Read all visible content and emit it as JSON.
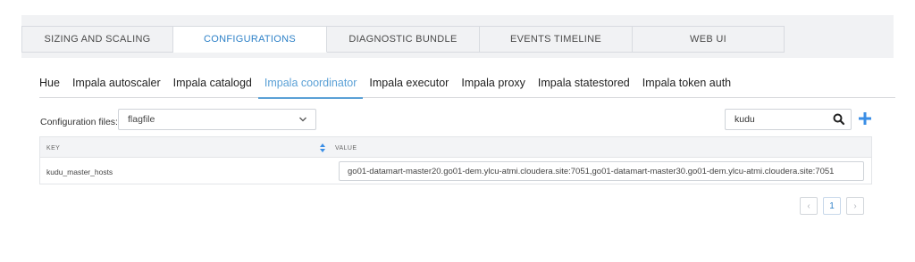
{
  "top_tabs": [
    {
      "label": "SIZING AND SCALING"
    },
    {
      "label": "CONFIGURATIONS"
    },
    {
      "label": "DIAGNOSTIC BUNDLE"
    },
    {
      "label": "EVENTS TIMELINE"
    },
    {
      "label": "WEB UI"
    }
  ],
  "active_top_tab": "CONFIGURATIONS",
  "sub_tabs": [
    {
      "label": "Hue"
    },
    {
      "label": "Impala autoscaler"
    },
    {
      "label": "Impala catalogd"
    },
    {
      "label": "Impala coordinator"
    },
    {
      "label": "Impala executor"
    },
    {
      "label": "Impala proxy"
    },
    {
      "label": "Impala statestored"
    },
    {
      "label": "Impala token auth"
    }
  ],
  "active_sub_tab": "Impala coordinator",
  "config": {
    "files_label": "Configuration files:",
    "selected_file": "flagfile",
    "search_value": "kudu"
  },
  "table": {
    "headers": {
      "key": "KEY",
      "value": "VALUE"
    },
    "rows": [
      {
        "key": "kudu_master_hosts",
        "value": "go01-datamart-master20.go01-dem.ylcu-atmi.cloudera.site:7051,go01-datamart-master30.go01-dem.ylcu-atmi.cloudera.site:7051"
      }
    ]
  },
  "pagination": {
    "prev": "‹",
    "current": "1",
    "next": "›"
  },
  "icons": {
    "search": "search-icon",
    "add": "plus-icon",
    "select_chevron": "chevron-down-icon",
    "sort": "sort-icon"
  },
  "colors": {
    "accent": "#2f82c8",
    "sub_tab_accent": "#5aa0d6",
    "add_button": "#3a8ee6",
    "background": "#f1f2f4"
  }
}
